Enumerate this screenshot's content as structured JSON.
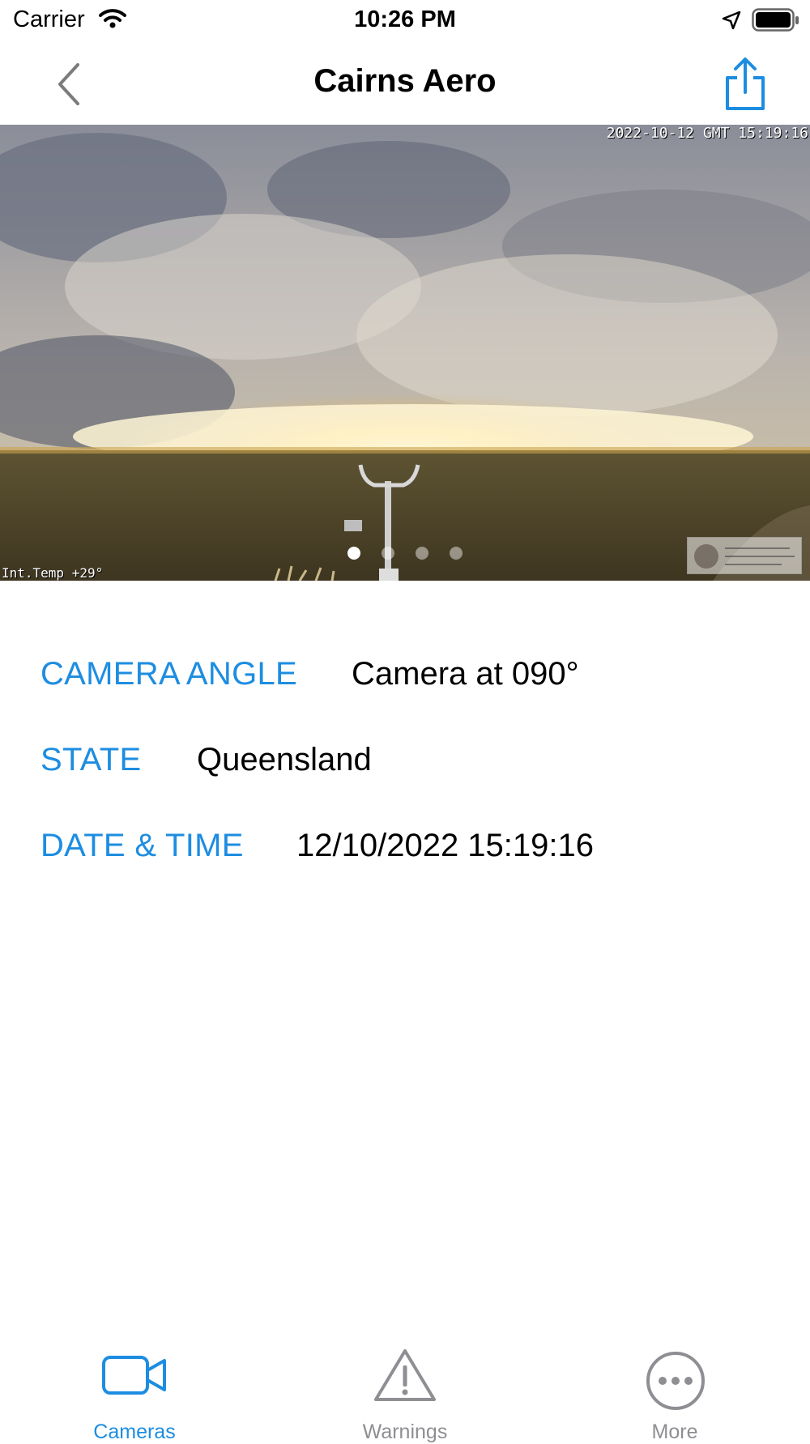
{
  "status_bar": {
    "carrier": "Carrier",
    "time": "10:26 PM"
  },
  "nav": {
    "title": "Cairns Aero",
    "back_icon": "chevron-left-icon",
    "share_icon": "share-icon"
  },
  "camera_image": {
    "timestamp_overlay": "2022-10-12 GMT 15:19:16",
    "temp_overlay": "Int.Temp +29°",
    "page_count": 4,
    "current_page": 1
  },
  "details": {
    "camera_angle_label": "CAMERA ANGLE",
    "camera_angle_value": "Camera at 090°",
    "state_label": "STATE",
    "state_value": "Queensland",
    "datetime_label": "DATE & TIME",
    "datetime_value": "12/10/2022 15:19:16"
  },
  "tabs": [
    {
      "label": "Cameras",
      "icon": "video-camera-icon",
      "selected": true
    },
    {
      "label": "Warnings",
      "icon": "warning-triangle-icon",
      "selected": false
    },
    {
      "label": "More",
      "icon": "more-ellipsis-icon",
      "selected": false
    }
  ],
  "colors": {
    "accent": "#1d8de1",
    "tab_inactive": "#8e8e93",
    "text": "#000000"
  }
}
